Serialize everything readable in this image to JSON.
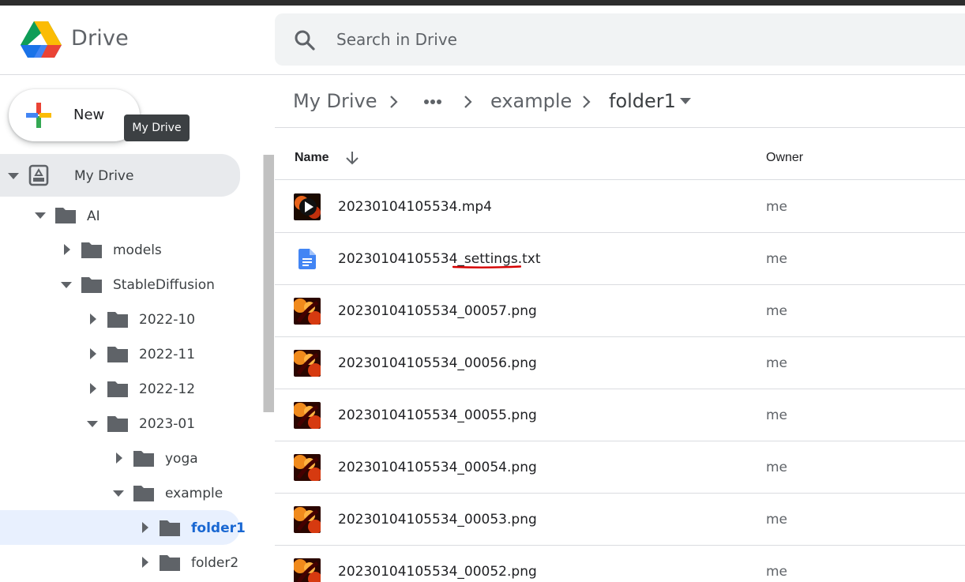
{
  "app": {
    "name": "Drive"
  },
  "search": {
    "placeholder": "Search in Drive"
  },
  "new_button": {
    "label": "New"
  },
  "tooltip": "My Drive",
  "sidebar": {
    "tree": [
      {
        "label": "My Drive"
      },
      {
        "label": "AI"
      },
      {
        "label": "models"
      },
      {
        "label": "StableDiffusion"
      },
      {
        "label": "2022-10"
      },
      {
        "label": "2022-11"
      },
      {
        "label": "2022-12"
      },
      {
        "label": "2023-01"
      },
      {
        "label": "yoga"
      },
      {
        "label": "example"
      },
      {
        "label": "folder1"
      },
      {
        "label": "folder2"
      }
    ]
  },
  "breadcrumb": [
    "My Drive",
    "example",
    "folder1"
  ],
  "columns": {
    "name": "Name",
    "owner": "Owner"
  },
  "files": [
    {
      "name": "20230104105534.mp4",
      "owner": "me",
      "type": "video"
    },
    {
      "name": "20230104105534_settings.txt",
      "owner": "me",
      "type": "text"
    },
    {
      "name": "20230104105534_00057.png",
      "owner": "me",
      "type": "image"
    },
    {
      "name": "20230104105534_00056.png",
      "owner": "me",
      "type": "image"
    },
    {
      "name": "20230104105534_00055.png",
      "owner": "me",
      "type": "image"
    },
    {
      "name": "20230104105534_00054.png",
      "owner": "me",
      "type": "image"
    },
    {
      "name": "20230104105534_00053.png",
      "owner": "me",
      "type": "image"
    },
    {
      "name": "20230104105534_00052.png",
      "owner": "me",
      "type": "image"
    }
  ],
  "colors": {
    "selected_text": "#1967d2",
    "selected_bg": "#e8f0fe",
    "doc_icon": "#4285f4"
  }
}
